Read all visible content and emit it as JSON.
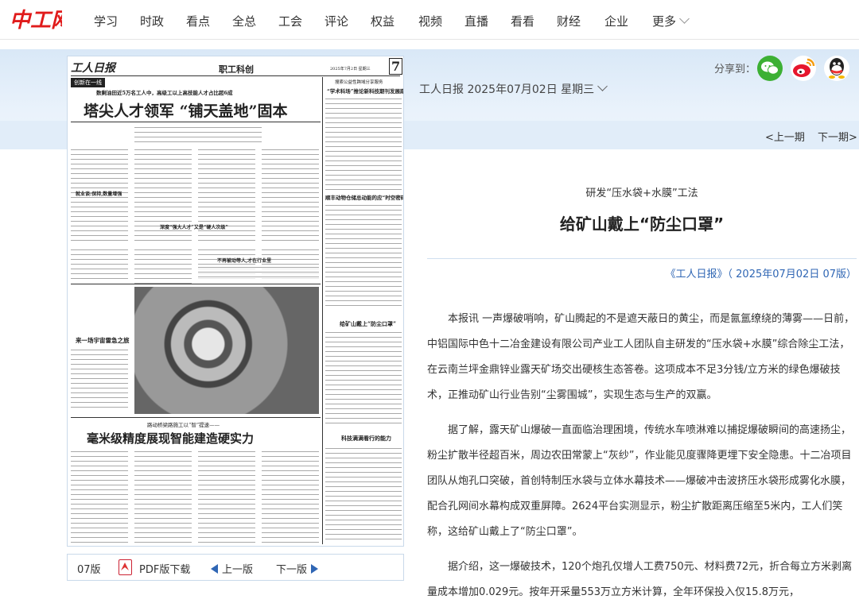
{
  "site": {
    "logo_text": "中工网"
  },
  "nav": {
    "items": [
      "学习",
      "时政",
      "看点",
      "全总",
      "工会",
      "评论",
      "权益",
      "视频",
      "直播",
      "看看",
      "财经",
      "企业"
    ],
    "more": "更多"
  },
  "share": {
    "label": "分享到：",
    "icons": [
      "wechat-icon",
      "weibo-icon",
      "qq-icon"
    ]
  },
  "issue": {
    "label": "工人日报 2025年07月02日 星期三"
  },
  "pager": {
    "prev": "<上一期",
    "next": "下一期>"
  },
  "newspaper_page": {
    "masthead": "工人日报",
    "section": "职工科创",
    "page_no": "7",
    "date_line": "2025年7月2日 星期三",
    "column_tag": "创新在一线",
    "lead_subtitle": "数剩油田近5万名工人中，高级工以上高技能人才占比超6成",
    "lead_title": "塔尖人才领军 “铺天盖地”固本",
    "right_kicker1": "搜索公益性跨域分享服务",
    "right_title1": "“学术科场”推论新科技期刊发展路线",
    "right_title2": "顺丰动物仓储总动能的应“时空密码”",
    "right_title3": "给矿山戴上“防尘口罩”",
    "right_title4": "科技满满看行的能力",
    "sub_title1": "就业谈:保持,数量增强",
    "sub_title2": "深度“强大人才”又是“硬人次级”",
    "sub_title3": "不再被动等人,才在行业里",
    "photo_caption": "来一场宇宙雷急之旅",
    "bottom_kicker": "路动桥梁路施工以“智”提速——",
    "bottom_title": "毫米级精度展现智能建造硬实力"
  },
  "article": {
    "kicker": "研发“压水袋+水膜”工法",
    "title": "给矿山戴上“防尘口罩”",
    "source": "《工人日报》（ 2025年07月02日 07版）",
    "paragraphs": [
      "本报讯 一声爆破哨响，矿山腾起的不是遮天蔽日的黄尘，而是氤氲缭绕的薄雾——日前，中铝国际中色十二冶金建设有限公司产业工人团队自主研发的“压水袋+水膜”综合除尘工法，在云南兰坪金鼎锌业露天矿场交出硬核生态答卷。这项成本不足3分钱/立方米的绿色爆破技术，正推动矿山行业告别“尘雾围城”，实现生态与生产的双赢。",
      "据了解，露天矿山爆破一直面临治理困境，传统水车喷淋难以捕捉爆破瞬间的高速扬尘，粉尘扩散半径超百米，周边农田常蒙上“灰纱”，作业能见度骤降更埋下安全隐患。十二冶项目团队从炮孔口突破，首创特制压水袋与立体水幕技术——爆破冲击波挤压水袋形成雾化水膜，配合孔网间水幕构成双重屏障。2624平台实测显示，粉尘扩散距离压缩至5米内，工人们笑称，这给矿山戴上了“防尘口罩”。",
      "据介绍，这一爆破技术，120个炮孔仅增人工费750元、材料费72元，折合每立方米剥离量成本增加0.029元。按年开采量553万立方米计算，全年环保投入仅15.8万元，"
    ]
  },
  "toolbar": {
    "edition": "07版",
    "pdf": "PDF版下载",
    "prev": "上一版",
    "next": "下一版"
  },
  "colors": {
    "brand_red": "#e01b1b",
    "link_blue": "#2f66b4",
    "band_blue": "#d9e8f7"
  }
}
